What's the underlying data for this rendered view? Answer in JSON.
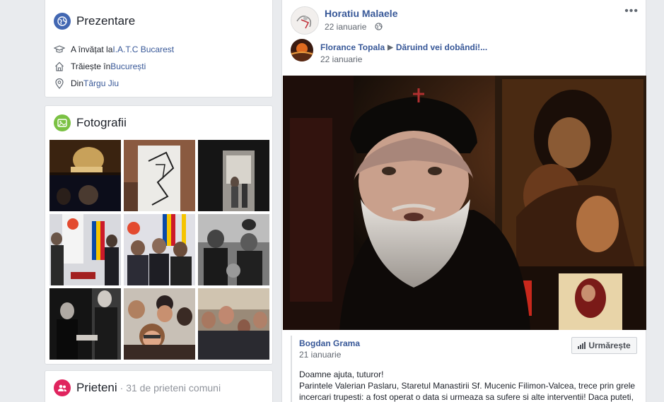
{
  "intro": {
    "title": "Prezentare",
    "studied_prefix": "A învățat la ",
    "studied_link": "I.A.T.C Bucarest",
    "lives_prefix": "Trăiește în ",
    "lives_link": "București",
    "from_prefix": "Din ",
    "from_link": "Târgu Jiu",
    "icons": [
      "globe-icon",
      "graduation-cap-icon",
      "home-icon",
      "location-pin-icon"
    ]
  },
  "photos": {
    "title": "Fotografii",
    "count": 9
  },
  "friends": {
    "title": "Prieteni",
    "subtitle": "· 31 de prieteni comuni"
  },
  "post": {
    "author": "Horatiu Malaele",
    "date": "22 ianuarie",
    "more": "•••",
    "shared_from": "Florance Topala",
    "shared_arrow": "▶",
    "shared_to": "Dăruind vei dobândi!...",
    "shared_date": "22 ianuarie",
    "inner_author": "Bogdan Grama",
    "inner_date": "21 ianuarie",
    "follow_label": "Urmărește",
    "text_line1": "Doamne ajuta, tuturor!",
    "text_line2": "Parintele Valerian Paslaru, Staretul Manastirii Sf. Mucenic Filimon-Valcea, trece prin grele incercari trupesti: a fost operat o data si urmeaza sa sufere si alte interventii! Daca puteti,"
  },
  "colors": {
    "link": "#385898",
    "intro_icon": "#4267b2",
    "photos_icon": "#7ac143",
    "friends_icon": "#e0245e"
  }
}
